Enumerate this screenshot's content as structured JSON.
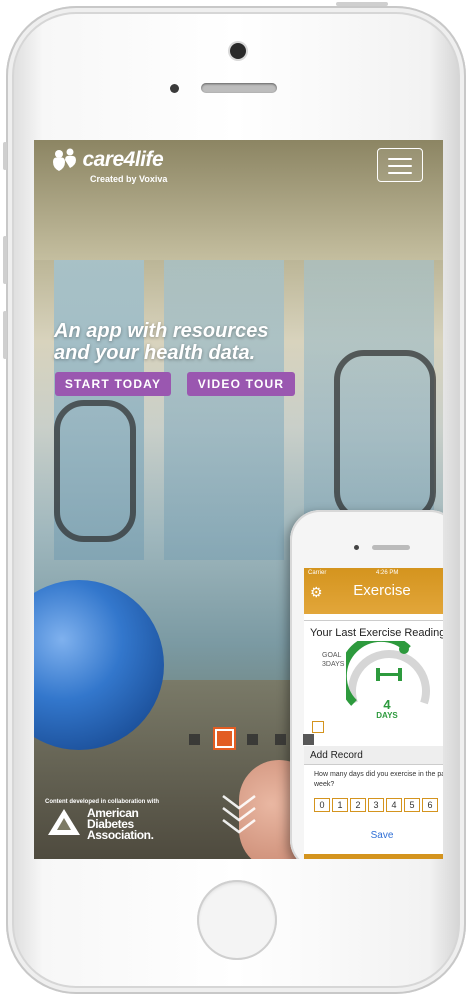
{
  "app": {
    "logo_name": "care4life",
    "logo_sub": "Created by Voxiva",
    "menu_icon": "hamburger-icon"
  },
  "hero": {
    "headline_line1": "An app with resources",
    "headline_line2": "and your health data.",
    "start_label": "START TODAY",
    "tour_label": "VIDEO TOUR"
  },
  "carousel": {
    "count": 5,
    "active_index": 1
  },
  "footer": {
    "collab_text": "Content developed in collaboration with",
    "ada_line1": "American",
    "ada_line2": "Diabetes",
    "ada_line3": "Association."
  },
  "device_preview": {
    "carrier": "Carrier",
    "time": "4:26 PM",
    "title": "Exercise",
    "reading_header": "Your Last Exercise Reading",
    "goal_label": "GOAL",
    "goal_value": "3DAYS",
    "days_value": "4",
    "days_label": "DAYS",
    "add_record": "Add Record",
    "question": "How many days did you exercise in the past week?",
    "options": [
      "0",
      "1",
      "2",
      "3",
      "4",
      "5",
      "6"
    ],
    "save_label": "Save"
  },
  "colors": {
    "accent_purple": "#9a57b0",
    "active_dot": "#e25d23",
    "app_gold": "#d4941e",
    "goal_green": "#2d9a3d"
  }
}
